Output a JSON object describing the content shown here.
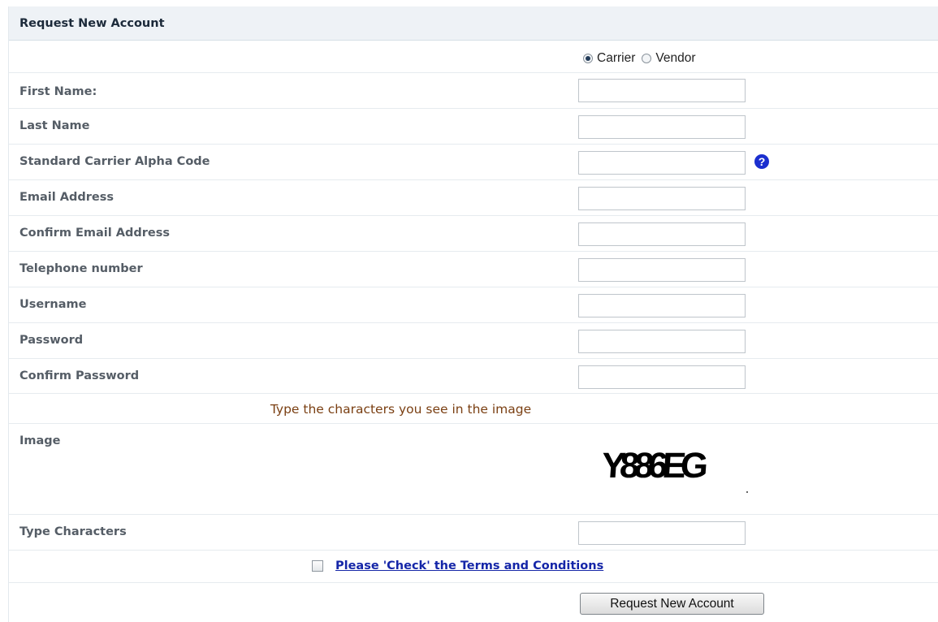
{
  "form": {
    "title": "Request New Account",
    "account_type": {
      "options": [
        {
          "label": "Carrier",
          "checked": true
        },
        {
          "label": "Vendor",
          "checked": false
        }
      ]
    },
    "fields": {
      "first_name": {
        "label": "First Name:",
        "value": ""
      },
      "last_name": {
        "label": "Last Name",
        "value": ""
      },
      "scac": {
        "label": "Standard Carrier Alpha Code",
        "value": "",
        "help_icon": "question-circle-icon",
        "help_glyph": "?"
      },
      "email": {
        "label": "Email Address",
        "value": ""
      },
      "confirm_email": {
        "label": "Confirm Email Address",
        "value": ""
      },
      "telephone": {
        "label": "Telephone number",
        "value": ""
      },
      "username": {
        "label": "Username",
        "value": ""
      },
      "password": {
        "label": "Password",
        "value": ""
      },
      "confirm_password": {
        "label": "Confirm Password",
        "value": ""
      },
      "type_characters": {
        "label": "Type Characters",
        "value": ""
      }
    },
    "captcha": {
      "instruction": "Type the characters you see in the image",
      "label": "Image",
      "text": "Y886EG"
    },
    "terms": {
      "checked": false,
      "link_text": "Please 'Check' the Terms and Conditions"
    },
    "submit_label": "Request New Account"
  },
  "colors": {
    "header_bg": "#eef2f6",
    "link": "#1526a8",
    "instruction_text": "#7a3f12",
    "help_icon": "#1b2fcf"
  }
}
